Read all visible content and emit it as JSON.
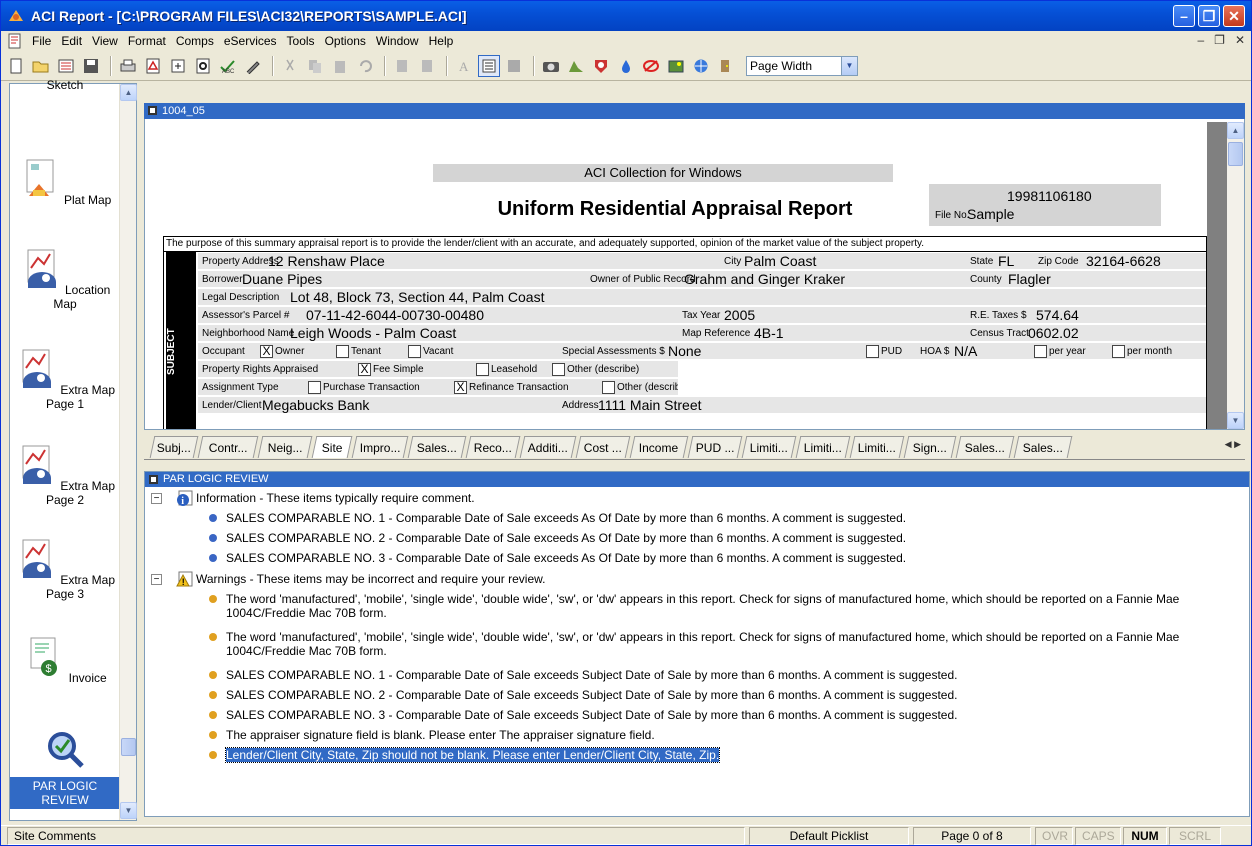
{
  "window": {
    "title": "ACI Report - [C:\\PROGRAM FILES\\ACI32\\REPORTS\\SAMPLE.ACI]"
  },
  "menu": [
    "File",
    "Edit",
    "View",
    "Format",
    "Comps",
    "eServices",
    "Tools",
    "Options",
    "Window",
    "Help"
  ],
  "toolbar": {
    "zoom_value": "Page Width"
  },
  "left_panel": {
    "items": [
      "Sketch",
      "Plat Map",
      "Location Map",
      "Extra Map Page 1",
      "Extra Map Page 2",
      "Extra Map Page 3",
      "Invoice",
      "PAR LOGIC REVIEW"
    ],
    "item_icons": [
      "sketch-icon",
      "plat-map-icon",
      "location-map-icon",
      "extra-map-icon",
      "extra-map-icon",
      "extra-map-icon",
      "invoice-icon",
      "par-logic-review-icon"
    ]
  },
  "document": {
    "window_title": "1004_05",
    "header": "ACI Collection for Windows",
    "form_title": "Uniform Residential Appraisal Report",
    "file_no_number": "19981106180",
    "file_no_label": "File No.",
    "file_no_value": "Sample",
    "purpose": "The purpose of this summary appraisal report is to provide the lender/client with an accurate, and adequately supported, opinion of the market value of the subject property.",
    "section_label": "SUBJECT",
    "fields": {
      "property_address_label": "Property Address",
      "property_address": "12 Renshaw Place",
      "city_label": "City",
      "city": "Palm Coast",
      "state_label": "State",
      "state": "FL",
      "zip_label": "Zip Code",
      "zip": "32164-6628",
      "borrower_label": "Borrower",
      "borrower": "Duane Pipes",
      "owner_label": "Owner of Public Record",
      "owner": "Grahm and Ginger Kraker",
      "county_label": "County",
      "county": "Flagler",
      "legal_label": "Legal Description",
      "legal": "Lot 48, Block 73, Section 44, Palm Coast",
      "parcel_label": "Assessor's Parcel #",
      "parcel": "07-11-42-6044-00730-00480",
      "tax_year_label": "Tax Year",
      "tax_year": "2005",
      "re_taxes_label": "R.E. Taxes $",
      "re_taxes": "574.64",
      "neighborhood_label": "Neighborhood Name",
      "neighborhood": "Leigh Woods - Palm Coast",
      "map_ref_label": "Map Reference",
      "map_ref": "4B-1",
      "census_label": "Census Tract",
      "census": "0602.02",
      "occupant_label": "Occupant",
      "owner_cb": "Owner",
      "tenant_cb": "Tenant",
      "vacant_cb": "Vacant",
      "special_label": "Special Assessments $",
      "special": "None",
      "pud_cb": "PUD",
      "hoa_label": "HOA $",
      "hoa": "N/A",
      "per_year_cb": "per year",
      "per_month_cb": "per month",
      "rights_label": "Property Rights Appraised",
      "fee_simple_cb": "Fee Simple",
      "leasehold_cb": "Leasehold",
      "other_describe_cb": "Other (describe)",
      "assignment_label": "Assignment Type",
      "purchase_cb": "Purchase Transaction",
      "refinance_cb": "Refinance Transaction",
      "other_describe_cb2": "Other (describe)",
      "lender_label": "Lender/Client",
      "lender": "Megabucks Bank",
      "address_label": "Address",
      "address": "1111 Main Street"
    }
  },
  "tabs": [
    "Subj...",
    "Contr...",
    "Neig...",
    "Site",
    "Impro...",
    "Sales...",
    "Reco...",
    "Additi...",
    "Cost ...",
    "Income",
    "PUD ...",
    "Limiti...",
    "Limiti...",
    "Limiti...",
    "Sign...",
    "Sales...",
    "Sales..."
  ],
  "review": {
    "title": "PAR LOGIC REVIEW",
    "info_header": "Information - These items typically require comment.",
    "info_items": [
      "SALES COMPARABLE NO. 1 - Comparable Date of Sale exceeds As Of Date by more than 6 months. A comment is suggested.",
      "SALES COMPARABLE NO. 2 - Comparable Date of Sale exceeds As Of Date by more than 6 months. A comment is suggested.",
      "SALES COMPARABLE NO. 3 - Comparable Date of Sale exceeds As Of Date by more than 6 months. A comment is suggested."
    ],
    "warn_header": "Warnings - These items may be incorrect and require your review.",
    "warn_items": [
      "The word 'manufactured', 'mobile', 'single wide', 'double wide', 'sw', or 'dw' appears in this report. Check for signs of manufactured home, which should be reported on a Fannie Mae 1004C/Freddie Mac 70B form.",
      "The word 'manufactured', 'mobile', 'single wide', 'double wide', 'sw', or 'dw' appears in this report. Check for signs of manufactured home, which should be reported on a Fannie Mae 1004C/Freddie Mac 70B form.",
      "SALES COMPARABLE NO. 1 - Comparable Date of Sale exceeds Subject Date of Sale by more than 6 months. A comment is suggested.",
      "SALES COMPARABLE NO. 2 - Comparable Date of Sale exceeds Subject Date of Sale by more than 6 months. A comment is suggested.",
      "SALES COMPARABLE NO. 3 - Comparable Date of Sale exceeds Subject Date of Sale by more than 6 months. A comment is suggested.",
      "The appraiser signature field is blank. Please enter The appraiser signature field.",
      "Lender/Client City, State, Zip should not be blank. Please enter Lender/Client City, State, Zip."
    ],
    "info_dot_color": "#3a66c4",
    "warn_dot_color": "#e0a020"
  },
  "status": {
    "left": "Site Comments",
    "picklist": "Default Picklist",
    "page": "Page 0 of 8",
    "ovr": "OVR",
    "caps": "CAPS",
    "num": "NUM",
    "scrl": "SCRL"
  }
}
